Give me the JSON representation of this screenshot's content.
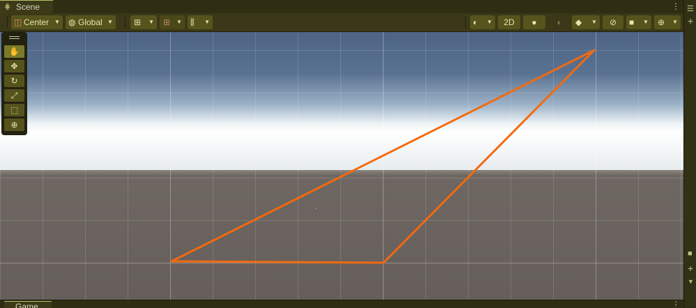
{
  "tabs": {
    "scene": "Scene",
    "game": "Game"
  },
  "tab_menu": "⋮",
  "toolbar": {
    "pivot": "Center",
    "space": "Global",
    "mode_2d": "2D"
  },
  "tools": [
    "hand",
    "move",
    "rotate",
    "scale",
    "rect",
    "transform"
  ],
  "colors": {
    "accent": "#b8c66a",
    "gizmo_stroke": "#f26a10",
    "toolbar_bg": "#3a3818",
    "button_bg": "#56541c"
  }
}
